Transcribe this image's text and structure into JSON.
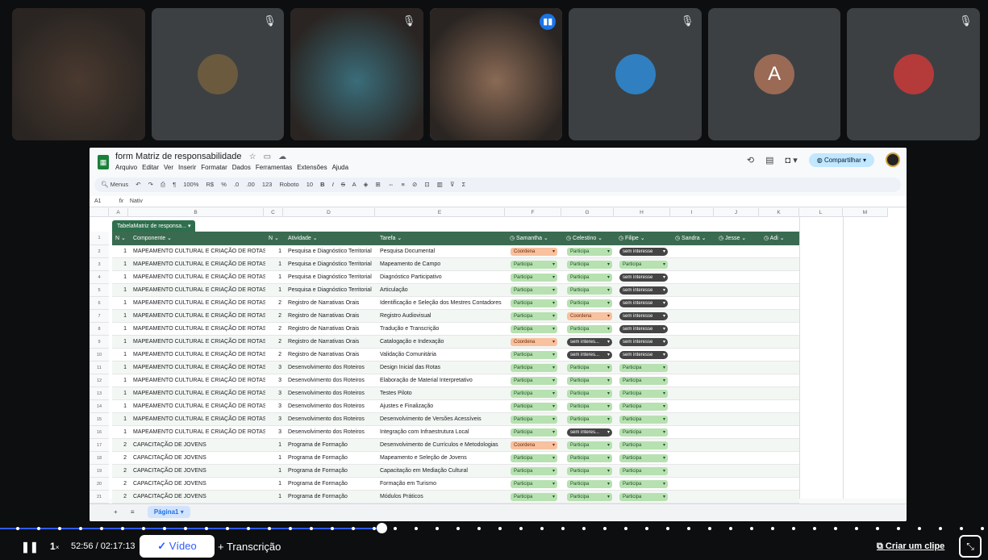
{
  "sheet": {
    "title": "form Matriz de responsabilidade",
    "menus": [
      "Arquivo",
      "Editar",
      "Ver",
      "Inserir",
      "Formatar",
      "Dados",
      "Ferramentas",
      "Extensões",
      "Ajuda"
    ],
    "share_label": "Compartilhar",
    "toolbar": {
      "menus_label": "Menus",
      "zoom": "100%",
      "currency": "R$",
      "percent": "%",
      "dec_minus": ".0",
      "dec_plus": ".00",
      "numfmt": "123",
      "font": "Roboto",
      "font_size": "10"
    },
    "formula": {
      "cell_ref": "A1",
      "content": "Nativ"
    },
    "columns": [
      "A",
      "B",
      "C",
      "D",
      "E",
      "F",
      "G",
      "H",
      "I",
      "J",
      "K",
      "L",
      "M"
    ],
    "table_name": "TabelaMatriz de responsa...",
    "headers": {
      "n1": "N",
      "componente": "Componente",
      "n2": "N",
      "atividade": "Atividade",
      "tarefa": "Tarefa",
      "samantha": "Samantha",
      "celestino": "Celestino",
      "filipe": "Filipe",
      "sandra": "Sandra",
      "jesse": "Jesse",
      "adi": "Adi"
    },
    "header_row_num": "1",
    "rows": [
      {
        "num": "2",
        "n1": "1",
        "componente": "MAPEAMENTO CULTURAL E CRIAÇÃO DE ROTAS",
        "n2": "1",
        "atividade": "Pesquisa e Diagnóstico Territorial",
        "tarefa": "Pesquisa Documental",
        "s": "Coordena",
        "c": "Participa",
        "f": "sem interesse"
      },
      {
        "num": "3",
        "n1": "1",
        "componente": "MAPEAMENTO CULTURAL E CRIAÇÃO DE ROTAS",
        "n2": "1",
        "atividade": "Pesquisa e Diagnóstico Territorial",
        "tarefa": "Mapeamento de Campo",
        "s": "Participa",
        "c": "Participa",
        "f": "Participa"
      },
      {
        "num": "4",
        "n1": "1",
        "componente": "MAPEAMENTO CULTURAL E CRIAÇÃO DE ROTAS",
        "n2": "1",
        "atividade": "Pesquisa e Diagnóstico Territorial",
        "tarefa": "Diagnóstico Participativo",
        "s": "Participa",
        "c": "Participa",
        "f": "sem interesse"
      },
      {
        "num": "5",
        "n1": "1",
        "componente": "MAPEAMENTO CULTURAL E CRIAÇÃO DE ROTAS",
        "n2": "1",
        "atividade": "Pesquisa e Diagnóstico Territorial",
        "tarefa": "Articulação",
        "s": "Participa",
        "c": "Participa",
        "f": "sem interesse"
      },
      {
        "num": "6",
        "n1": "1",
        "componente": "MAPEAMENTO CULTURAL E CRIAÇÃO DE ROTAS",
        "n2": "2",
        "atividade": "Registro de Narrativas Orais",
        "tarefa": "Identificação e Seleção dos Mestres Contadores",
        "s": "Participa",
        "c": "Participa",
        "f": "sem interesse"
      },
      {
        "num": "7",
        "n1": "1",
        "componente": "MAPEAMENTO CULTURAL E CRIAÇÃO DE ROTAS",
        "n2": "2",
        "atividade": "Registro de Narrativas Orais",
        "tarefa": "Registro Audiovisual",
        "s": "Participa",
        "c": "Coordena",
        "f": "sem interesse"
      },
      {
        "num": "8",
        "n1": "1",
        "componente": "MAPEAMENTO CULTURAL E CRIAÇÃO DE ROTAS",
        "n2": "2",
        "atividade": "Registro de Narrativas Orais",
        "tarefa": "Tradução e Transcrição",
        "s": "Participa",
        "c": "Participa",
        "f": "sem interesse"
      },
      {
        "num": "9",
        "n1": "1",
        "componente": "MAPEAMENTO CULTURAL E CRIAÇÃO DE ROTAS",
        "n2": "2",
        "atividade": "Registro de Narrativas Orais",
        "tarefa": "Catalogação e Indexação",
        "s": "Coordena",
        "c": "sem interes...",
        "f": "sem interesse"
      },
      {
        "num": "10",
        "n1": "1",
        "componente": "MAPEAMENTO CULTURAL E CRIAÇÃO DE ROTAS",
        "n2": "2",
        "atividade": "Registro de Narrativas Orais",
        "tarefa": "Validação Comunitária",
        "s": "Participa",
        "c": "sem interes...",
        "f": "sem interesse"
      },
      {
        "num": "11",
        "n1": "1",
        "componente": "MAPEAMENTO CULTURAL E CRIAÇÃO DE ROTAS",
        "n2": "3",
        "atividade": "Desenvolvimento dos Roteiros",
        "tarefa": "Design Inicial das Rotas",
        "s": "Participa",
        "c": "Participa",
        "f": "Participa"
      },
      {
        "num": "12",
        "n1": "1",
        "componente": "MAPEAMENTO CULTURAL E CRIAÇÃO DE ROTAS",
        "n2": "3",
        "atividade": "Desenvolvimento dos Roteiros",
        "tarefa": "Elaboração de Material Interpretativo",
        "s": "Participa",
        "c": "Participa",
        "f": "Participa"
      },
      {
        "num": "13",
        "n1": "1",
        "componente": "MAPEAMENTO CULTURAL E CRIAÇÃO DE ROTAS",
        "n2": "3",
        "atividade": "Desenvolvimento dos Roteiros",
        "tarefa": "Testes Piloto",
        "s": "Participa",
        "c": "Participa",
        "f": "Participa"
      },
      {
        "num": "14",
        "n1": "1",
        "componente": "MAPEAMENTO CULTURAL E CRIAÇÃO DE ROTAS",
        "n2": "3",
        "atividade": "Desenvolvimento dos Roteiros",
        "tarefa": "Ajustes e Finalização",
        "s": "Participa",
        "c": "Participa",
        "f": "Participa"
      },
      {
        "num": "15",
        "n1": "1",
        "componente": "MAPEAMENTO CULTURAL E CRIAÇÃO DE ROTAS",
        "n2": "3",
        "atividade": "Desenvolvimento dos Roteiros",
        "tarefa": "Desenvolvimento de Versões Acessíveis",
        "s": "Participa",
        "c": "Participa",
        "f": "Participa"
      },
      {
        "num": "16",
        "n1": "1",
        "componente": "MAPEAMENTO CULTURAL E CRIAÇÃO DE ROTAS",
        "n2": "3",
        "atividade": "Desenvolvimento dos Roteiros",
        "tarefa": "Integração com Infraestrutura Local",
        "s": "Participa",
        "c": "sem interes...",
        "f": "Participa"
      },
      {
        "num": "17",
        "n1": "2",
        "componente": "CAPACITAÇÃO DE JOVENS",
        "n2": "1",
        "atividade": "Programa de Formação",
        "tarefa": "Desenvolvimento de Currículos e Metodologias",
        "s": "Coordena",
        "c": "Participa",
        "f": "Participa"
      },
      {
        "num": "18",
        "n1": "2",
        "componente": "CAPACITAÇÃO DE JOVENS",
        "n2": "1",
        "atividade": "Programa de Formação",
        "tarefa": "Mapeamento e Seleção de Jovens",
        "s": "Participa",
        "c": "Participa",
        "f": "Participa"
      },
      {
        "num": "19",
        "n1": "2",
        "componente": "CAPACITAÇÃO DE JOVENS",
        "n2": "1",
        "atividade": "Programa de Formação",
        "tarefa": "Capacitação em Mediação Cultural",
        "s": "Participa",
        "c": "Participa",
        "f": "Participa"
      },
      {
        "num": "20",
        "n1": "2",
        "componente": "CAPACITAÇÃO DE JOVENS",
        "n2": "1",
        "atividade": "Programa de Formação",
        "tarefa": "Formação em Turismo",
        "s": "Participa",
        "c": "Participa",
        "f": "Participa"
      },
      {
        "num": "21",
        "n1": "2",
        "componente": "CAPACITAÇÃO DE JOVENS",
        "n2": "1",
        "atividade": "Programa de Formação",
        "tarefa": "Módulos Práticos",
        "s": "Participa",
        "c": "Participa",
        "f": "Participa"
      }
    ],
    "sheet_tab": "Página1"
  },
  "meeting": {
    "participants": [
      {
        "kind": "camera",
        "icon": "",
        "tone": "#4a3a30"
      },
      {
        "kind": "avatar",
        "icon": "mic-off-icon",
        "tone": "#6b5a3e"
      },
      {
        "kind": "camera",
        "icon": "mic-off-icon",
        "tone": "#3a6d7a"
      },
      {
        "kind": "camera",
        "icon": "speaking-icon",
        "tone": "#8a6a55",
        "active": true
      },
      {
        "kind": "avatar",
        "icon": "mic-off-icon",
        "tone": "#2f7fc1"
      },
      {
        "kind": "letter",
        "icon": "",
        "letter": "A"
      },
      {
        "kind": "avatar",
        "icon": "mic-off-icon",
        "tone": "#b53a3a"
      }
    ]
  },
  "player": {
    "speed": "1",
    "speed_suffix": "×",
    "time": "52:56 / 02:17:13",
    "video_label": "Vídeo",
    "transcript_label": "Transcrição",
    "clip_label": "Criar um clipe",
    "progress": 0.386
  }
}
